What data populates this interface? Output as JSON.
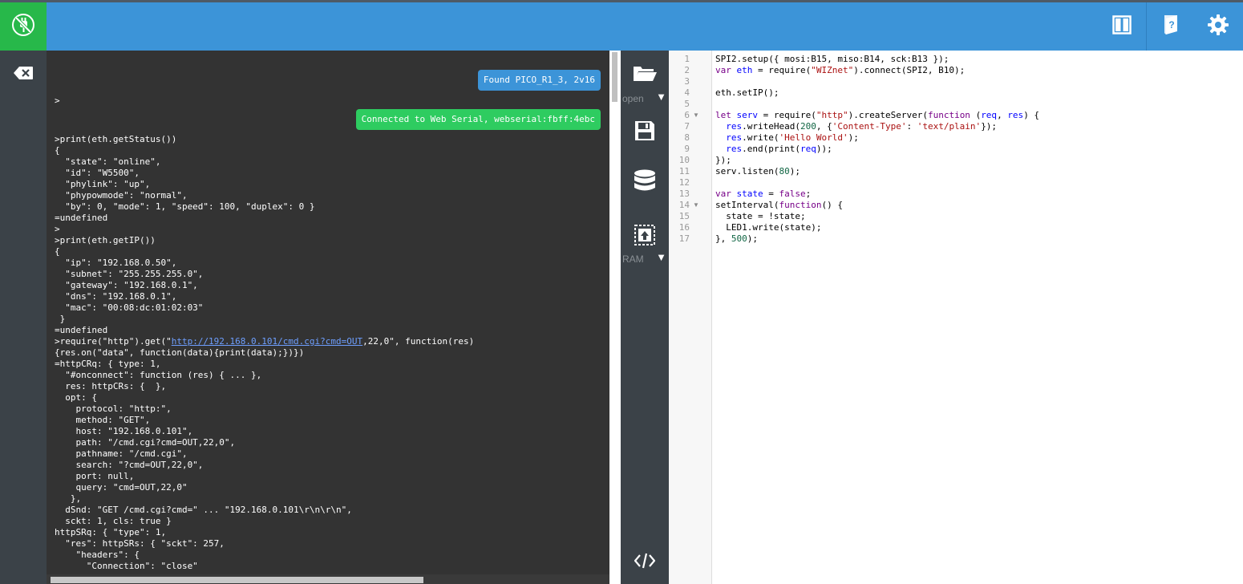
{
  "colors": {
    "topbar": "#3c94d8",
    "connect": "#27b84a",
    "sidebar": "#3b4248",
    "console_bg": "#333333",
    "editor_bg": "#ffffff"
  },
  "toolbar": {
    "connect_icon": "plug-disconnected-icon",
    "layout_icon": "split-layout-icon",
    "docs_icon": "help-book-icon",
    "settings_icon": "gear-icon"
  },
  "console": {
    "clear_icon": "clear-backspace-icon",
    "messages": [
      {
        "text": "Found PICO_R1_3, 2v16",
        "color": "#3c94d8"
      },
      {
        "text": "Connected to Web Serial, webserial:fbff:4ebc",
        "color": "#2ecc60"
      }
    ],
    "prompt": ">",
    "lines": [
      ">print(eth.getStatus())",
      "{",
      "  \"state\": \"online\",",
      "  \"id\": \"W5500\",",
      "  \"phylink\": \"up\",",
      "  \"phypowmode\": \"normal\",",
      "  \"by\": 0, \"mode\": 1, \"speed\": 100, \"duplex\": 0 }",
      "=undefined",
      ">",
      ">print(eth.getIP())",
      "{",
      "  \"ip\": \"192.168.0.50\",",
      "  \"subnet\": \"255.255.255.0\",",
      "  \"gateway\": \"192.168.0.1\",",
      "  \"dns\": \"192.168.0.1\",",
      "  \"mac\": \"00:08:dc:01:02:03\"",
      " }",
      "=undefined"
    ],
    "request_pre": ">require(\"http\").get(\"",
    "request_link": "http://192.168.0.101/cmd.cgi?cmd=OUT",
    "request_post": ",22,0\", function(res)",
    "lines2": [
      "{res.on(\"data\", function(data){print(data);})})",
      "=httpCRq: { type: 1,",
      "  \"#onconnect\": function (res) { ... },",
      "  res: httpCRs: {  },",
      "  opt: {",
      "    protocol: \"http:\",",
      "    method: \"GET\",",
      "    host: \"192.168.0.101\",",
      "    path: \"/cmd.cgi?cmd=OUT,22,0\",",
      "    pathname: \"/cmd.cgi\",",
      "    search: \"?cmd=OUT,22,0\",",
      "    port: null,",
      "    query: \"cmd=OUT,22,0\"",
      "   },",
      "  dSnd: \"GET /cmd.cgi?cmd=\" ... \"192.168.0.101\\r\\n\\r\\n\",",
      "  sckt: 1, cls: true }",
      "httpSRq: { \"type\": 1,",
      "  \"res\": httpSRs: { \"sckt\": 257,",
      "    \"headers\": {",
      "      \"Connection\": \"close\""
    ]
  },
  "sidebar": {
    "open_icon": "folder-open-icon",
    "open_label": "open",
    "save_icon": "save-disk-icon",
    "storage_icon": "database-icon",
    "upload_icon": "upload-chip-icon",
    "ram_label": "RAM",
    "dropdown_icon": "triangle-down-icon",
    "code_icon": "code-brackets-icon"
  },
  "editor": {
    "line_numbers": [
      "1",
      "2",
      "3",
      "4",
      "5",
      "6",
      "7",
      "8",
      "9",
      "10",
      "11",
      "12",
      "13",
      "14",
      "15",
      "16",
      "17"
    ],
    "lines": [
      [
        {
          "t": "SPI2.setup({ mosi:B15, miso:B14, sck:B13 });",
          "c": ""
        }
      ],
      [
        {
          "t": "var ",
          "c": "kw"
        },
        {
          "t": "eth",
          "c": "def"
        },
        {
          "t": " = require(",
          "c": ""
        },
        {
          "t": "\"WIZnet\"",
          "c": "str"
        },
        {
          "t": ").connect(SPI2, B10);",
          "c": ""
        }
      ],
      [],
      [
        {
          "t": "eth.setIP();",
          "c": ""
        }
      ],
      [],
      [
        {
          "t": "let ",
          "c": "kw"
        },
        {
          "t": "serv",
          "c": "def"
        },
        {
          "t": " = require(",
          "c": ""
        },
        {
          "t": "\"http\"",
          "c": "str"
        },
        {
          "t": ").createServer(",
          "c": ""
        },
        {
          "t": "function ",
          "c": "kw"
        },
        {
          "t": "(",
          "c": ""
        },
        {
          "t": "req",
          "c": "def"
        },
        {
          "t": ", ",
          "c": ""
        },
        {
          "t": "res",
          "c": "def"
        },
        {
          "t": ") {",
          "c": ""
        }
      ],
      [
        {
          "t": "  ",
          "c": ""
        },
        {
          "t": "res",
          "c": "def"
        },
        {
          "t": ".writeHead(",
          "c": ""
        },
        {
          "t": "200",
          "c": "num"
        },
        {
          "t": ", {",
          "c": ""
        },
        {
          "t": "'Content-Type'",
          "c": "str"
        },
        {
          "t": ": ",
          "c": ""
        },
        {
          "t": "'text/plain'",
          "c": "str"
        },
        {
          "t": "});",
          "c": ""
        }
      ],
      [
        {
          "t": "  ",
          "c": ""
        },
        {
          "t": "res",
          "c": "def"
        },
        {
          "t": ".write(",
          "c": ""
        },
        {
          "t": "'Hello World'",
          "c": "str"
        },
        {
          "t": ");",
          "c": ""
        }
      ],
      [
        {
          "t": "  ",
          "c": ""
        },
        {
          "t": "res",
          "c": "def"
        },
        {
          "t": ".end(print(",
          "c": ""
        },
        {
          "t": "req",
          "c": "def"
        },
        {
          "t": "));",
          "c": ""
        }
      ],
      [
        {
          "t": "});",
          "c": ""
        }
      ],
      [
        {
          "t": "serv.listen(",
          "c": ""
        },
        {
          "t": "80",
          "c": "num"
        },
        {
          "t": ");",
          "c": ""
        }
      ],
      [],
      [
        {
          "t": "var ",
          "c": "kw"
        },
        {
          "t": "state",
          "c": "def"
        },
        {
          "t": " = ",
          "c": ""
        },
        {
          "t": "false",
          "c": "kw"
        },
        {
          "t": ";",
          "c": ""
        }
      ],
      [
        {
          "t": "setInterval(",
          "c": ""
        },
        {
          "t": "function",
          "c": "kw"
        },
        {
          "t": "() {",
          "c": ""
        }
      ],
      [
        {
          "t": "  state = !state;",
          "c": ""
        }
      ],
      [
        {
          "t": "  LED1.write(state);",
          "c": ""
        }
      ],
      [
        {
          "t": "}, ",
          "c": ""
        },
        {
          "t": "500",
          "c": "num"
        },
        {
          "t": ");",
          "c": ""
        }
      ]
    ]
  }
}
